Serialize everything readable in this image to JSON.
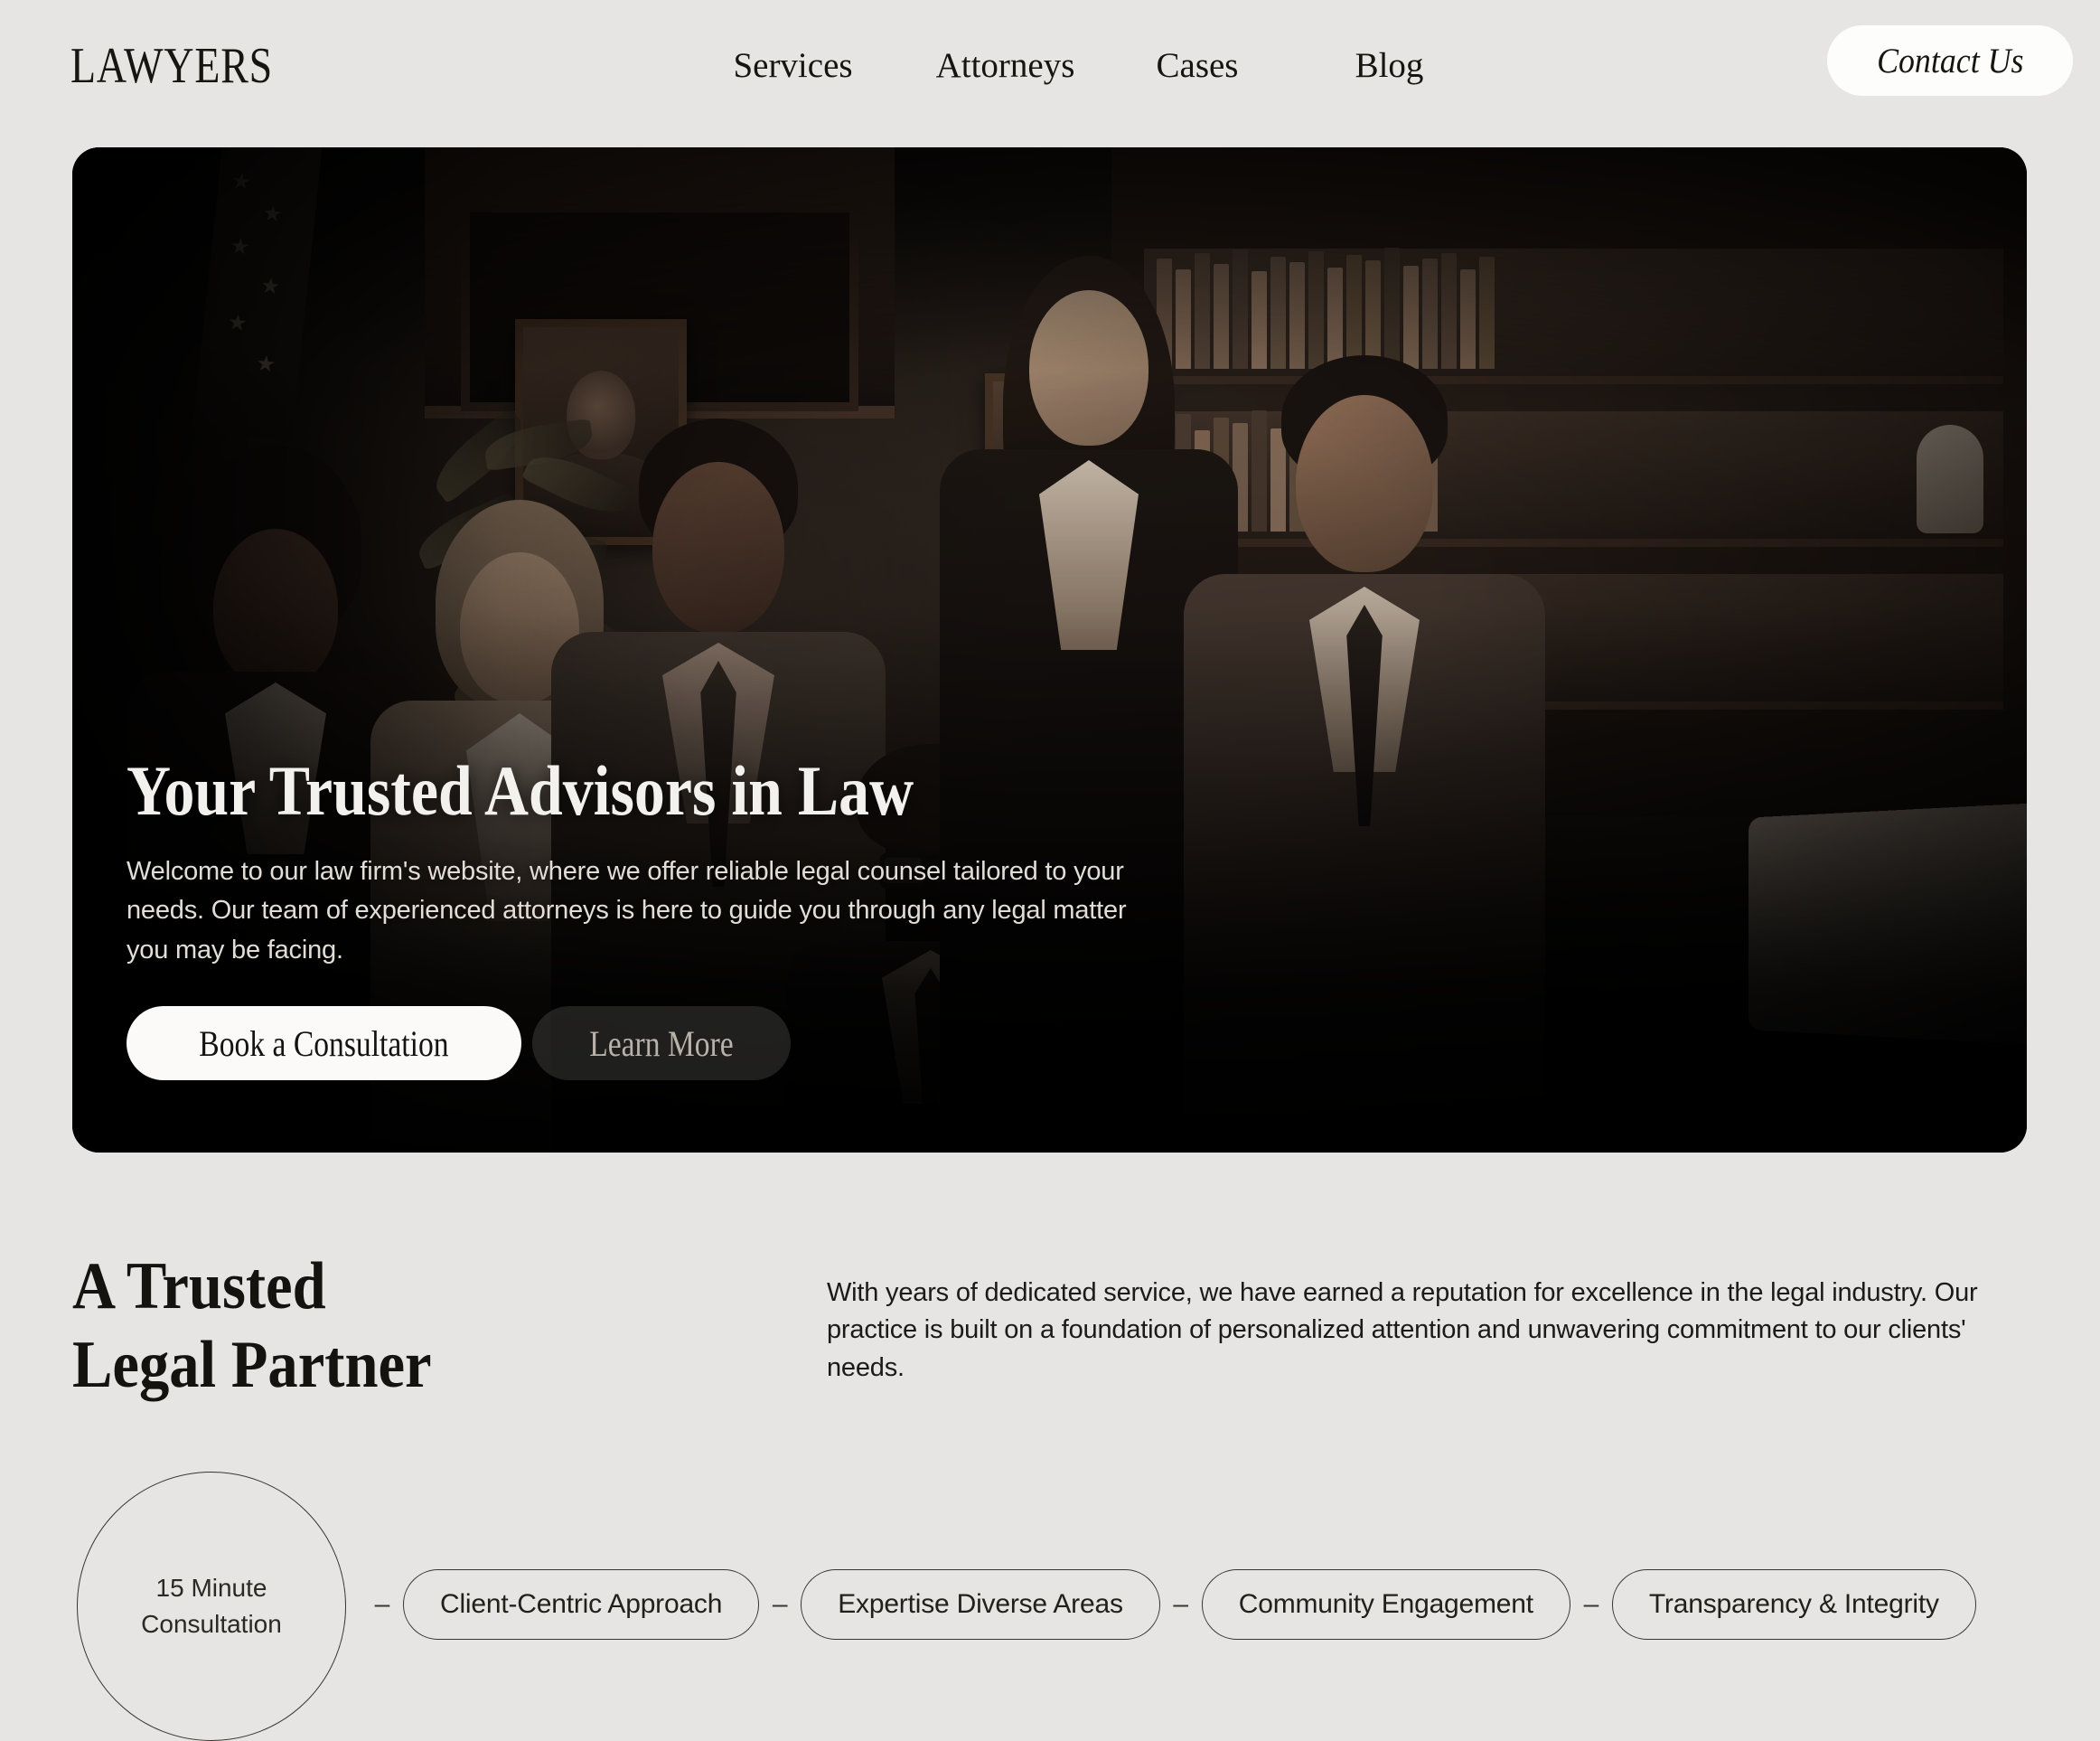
{
  "header": {
    "logo": "LAWYERS",
    "nav": [
      {
        "label": "Services"
      },
      {
        "label": "Attorneys"
      },
      {
        "label": "Cases"
      },
      {
        "label": "Blog"
      }
    ],
    "contact_button": "Contact Us"
  },
  "hero": {
    "title": "Your Trusted Advisors in Law",
    "subtitle": "Welcome to our law firm's website, where we offer reliable legal counsel tailored to your needs. Our team of experienced attorneys is here to guide you through any legal matter you may be facing.",
    "primary_button": "Book a Consultation",
    "secondary_button": "Learn More",
    "image_alt": "Team of seven attorneys standing in a dark wood-paneled law office with bookshelves, framed portraits and an American flag"
  },
  "about": {
    "title": "A Trusted\nLegal Partner",
    "body": "With years of dedicated service, we have earned a reputation for excellence in the legal industry. Our practice is built on a foundation of personalized attention and unwavering commitment to our clients' needs."
  },
  "features": {
    "badge": "15 Minute\nConsultation",
    "separator": "–",
    "chips": [
      {
        "label": "Client-Centric Approach"
      },
      {
        "label": "Expertise  Diverse Areas"
      },
      {
        "label": "Community Engagement"
      },
      {
        "label": "Transparency & Integrity"
      }
    ]
  },
  "colors": {
    "page_background": "#e6e5e3",
    "ink": "#15130f",
    "hero_background": "#0a0807",
    "button_light": "#fbfaf8",
    "outline": "#3b352f"
  }
}
